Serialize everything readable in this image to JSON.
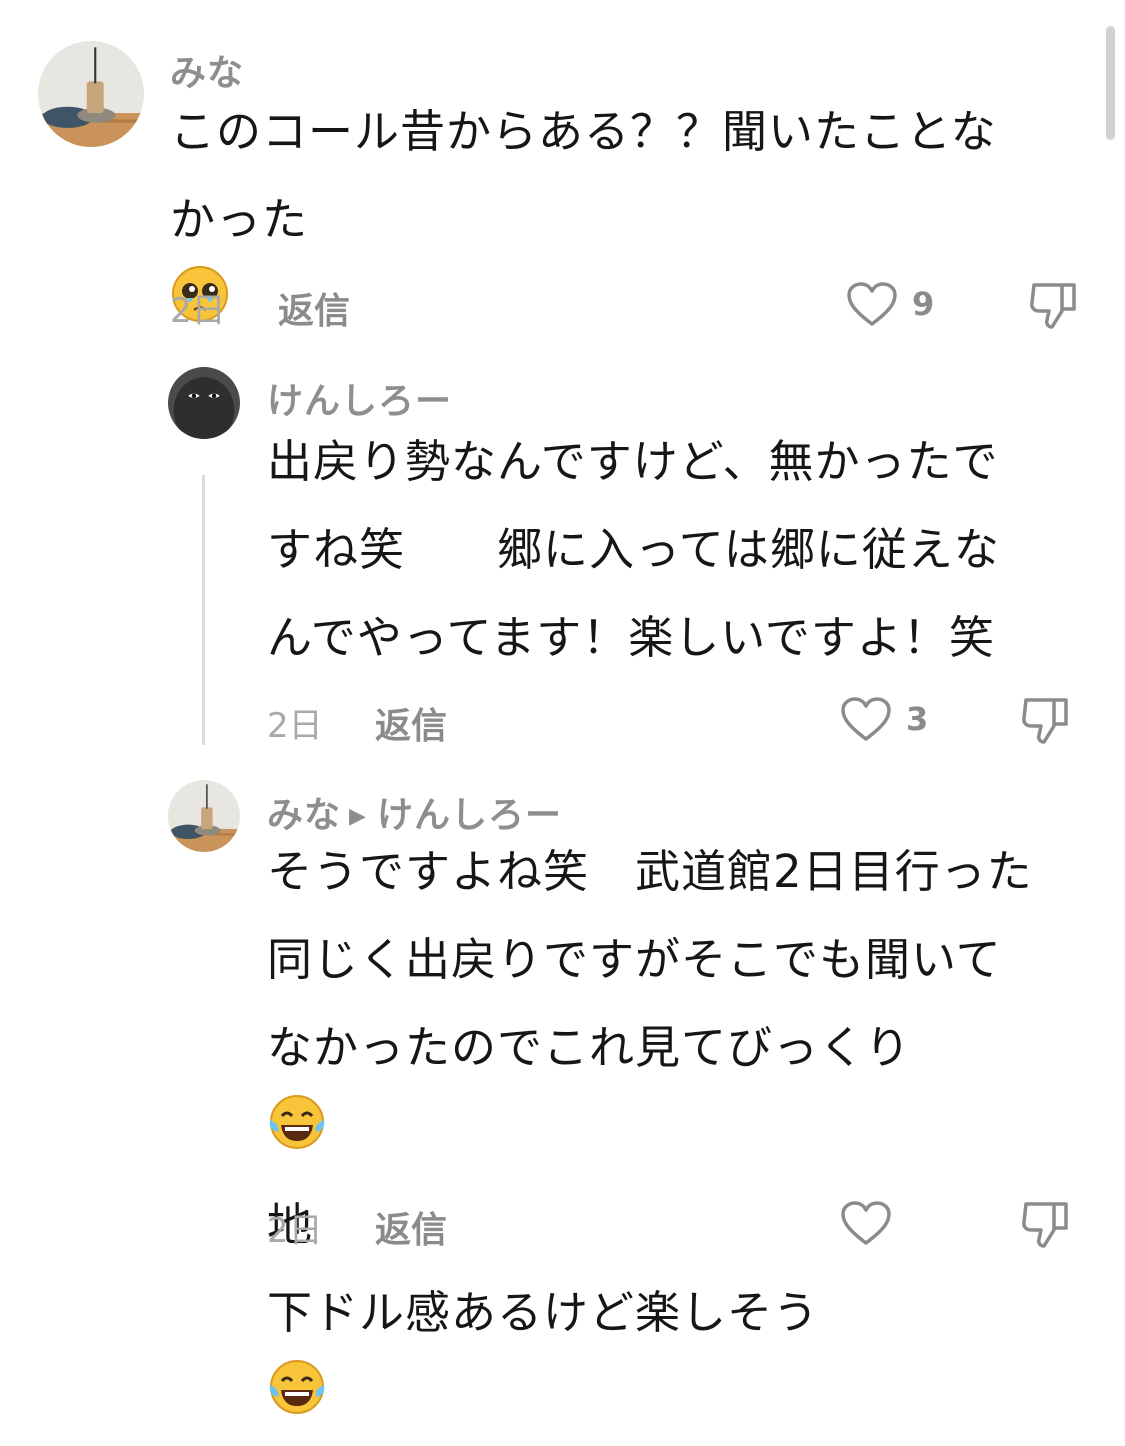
{
  "comments": [
    {
      "username": "みな",
      "lines": [
        "このコール昔からある？？聞いたことな",
        "かった"
      ],
      "emoji_icon": "pleading-face-icon",
      "time": "2日",
      "reply_label": "返信",
      "likes": "9"
    },
    {
      "username": "けんしろー",
      "lines": [
        "出戻り勢なんですけど、無かったで",
        "すね笑　　郷に入っては郷に従えな",
        "んでやってます！楽しいですよ！笑"
      ],
      "time": "2日",
      "reply_label": "返信",
      "likes": "3"
    },
    {
      "username": "みな",
      "reply_to": "けんしろー",
      "lines": [
        "そうですよね笑　武道館2日目行った",
        "同じく出戻りですがそこでも聞いて",
        "なかったのでこれ見てびっくり",
        "下ドル感あるけど楽しそう"
      ],
      "line3_suffix": "地",
      "emoji_icon": "laughing-crying-face-icon",
      "time": "2日",
      "reply_label": "返信",
      "likes": ""
    }
  ],
  "colors": {
    "username": "#8e8e8e",
    "text": "#161616",
    "meta": "#a9a9a9",
    "thread_line": "#dcdcdc"
  }
}
